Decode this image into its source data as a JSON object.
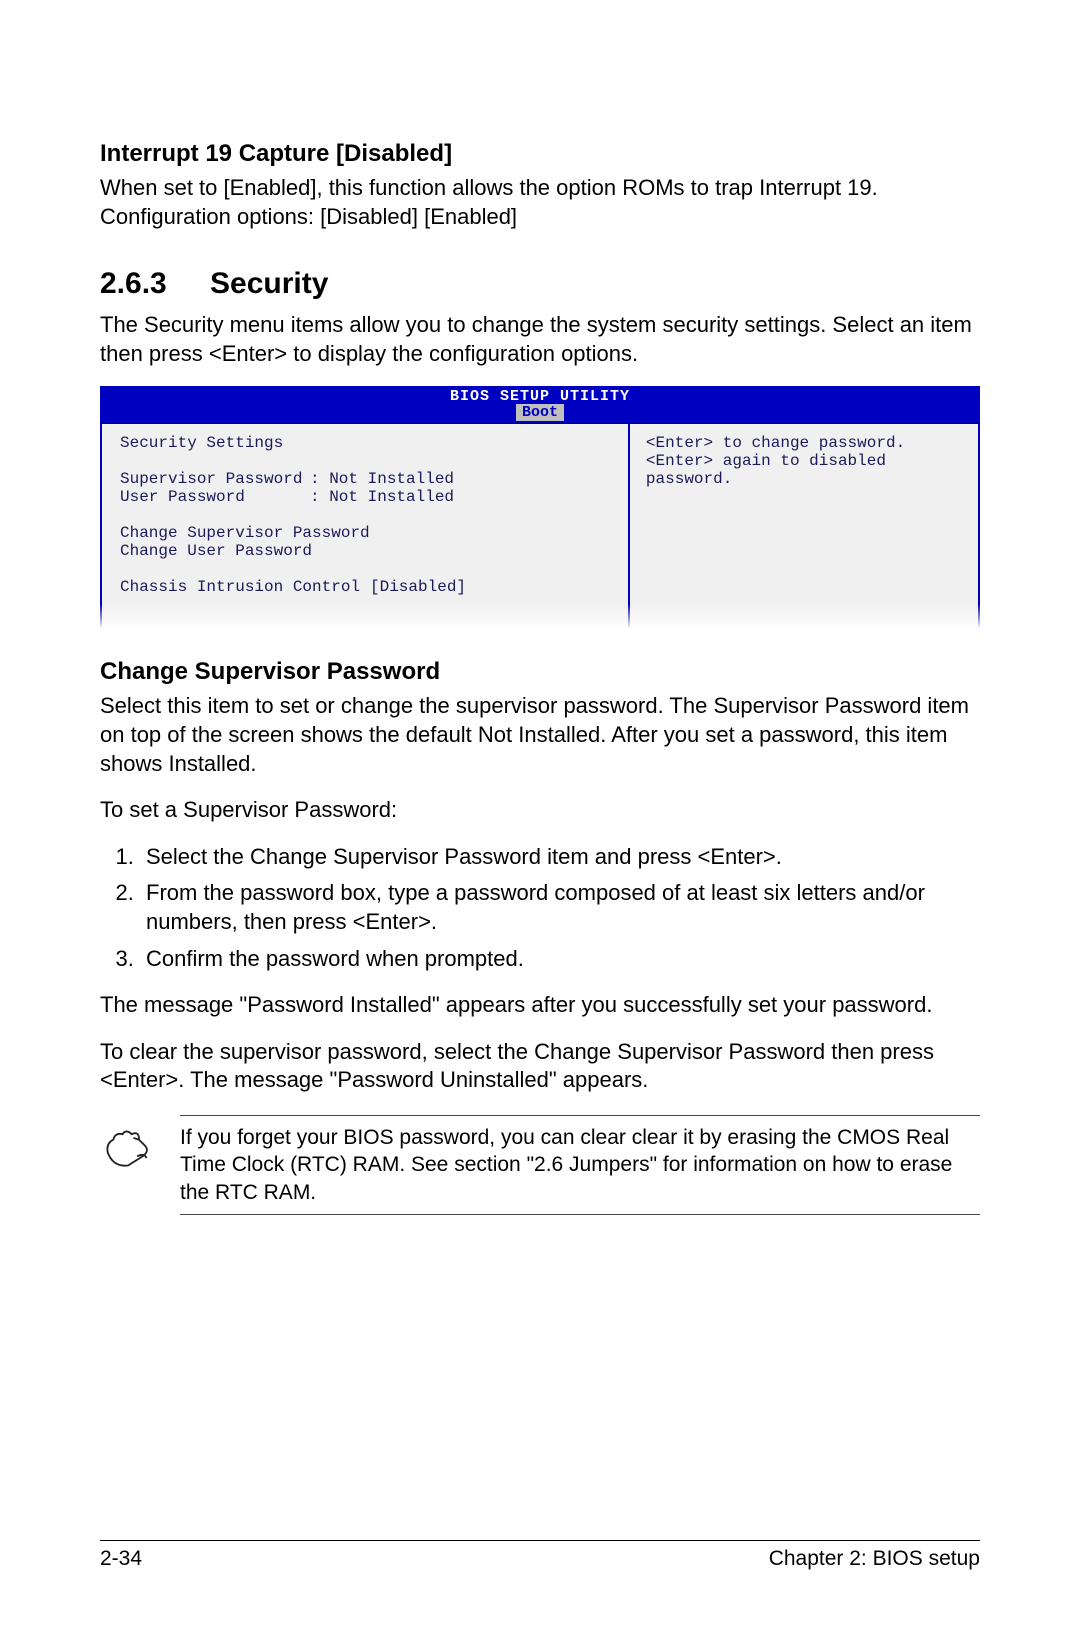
{
  "section1": {
    "heading": "Interrupt 19 Capture [Disabled]",
    "body": "When set to [Enabled], this function allows the option ROMs to trap Interrupt 19. Configuration options: [Disabled] [Enabled]"
  },
  "section2": {
    "number": "2.6.3",
    "title": "Security",
    "intro": "The Security menu items allow you to change the system security settings. Select an item then press <Enter> to display the configuration options."
  },
  "bios": {
    "title": "BIOS SETUP UTILITY",
    "tab": "Boot",
    "left": {
      "heading": "Security Settings",
      "rows": [
        {
          "label": "Supervisor Password",
          "value": ": Not Installed"
        },
        {
          "label": "User Password",
          "value": ": Not Installed"
        }
      ],
      "actions": [
        "Change Supervisor Password",
        "Change User Password"
      ],
      "option": {
        "label": "Chassis Intrusion Control",
        "value": "[Disabled]"
      }
    },
    "right": "<Enter> to change password.\n<Enter> again to disabled password."
  },
  "section3": {
    "heading": "Change Supervisor Password",
    "p1": "Select this item to set or change the supervisor password. The Supervisor Password item on top of the screen shows the default Not Installed. After you set a password, this item shows Installed.",
    "p2": "To set a Supervisor Password:",
    "steps": [
      "Select the Change Supervisor Password item and press <Enter>.",
      "From the password box, type a password composed of at least six letters and/or numbers, then press <Enter>.",
      "Confirm the password when prompted."
    ],
    "p3": "The message \"Password Installed\" appears after you successfully set your password.",
    "p4": "To clear the supervisor password, select the Change Supervisor Password then press <Enter>. The message \"Password Uninstalled\" appears."
  },
  "note": {
    "text": "If you forget your BIOS password, you can clear clear it by erasing the CMOS Real Time Clock (RTC) RAM. See section \"2.6  Jumpers\" for information on how to erase the RTC RAM."
  },
  "footer": {
    "left": "2-34",
    "right": "Chapter 2: BIOS setup"
  }
}
